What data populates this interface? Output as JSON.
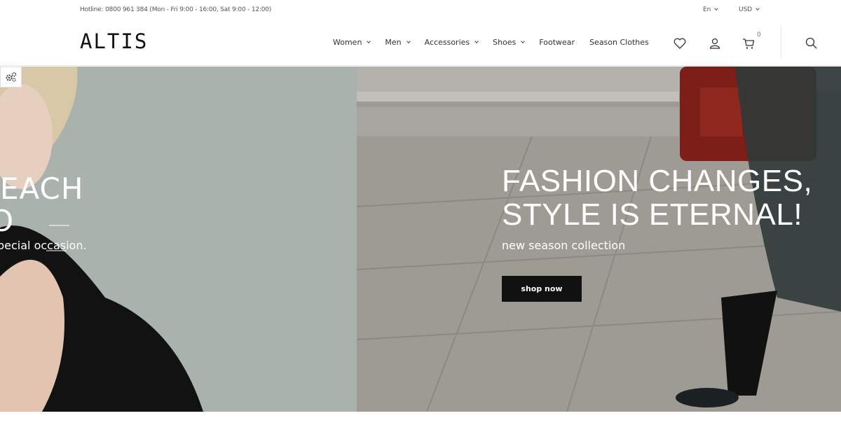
{
  "topbar": {
    "hotline": "Hotline: 0800 961 384 (Mon - Fri 9:00 - 16:00, Sat 9:00 - 12:00)",
    "language": "En",
    "currency": "USD"
  },
  "header": {
    "logo": "ALTIS",
    "nav": [
      {
        "label": "Women",
        "has_dropdown": true
      },
      {
        "label": "Men",
        "has_dropdown": true
      },
      {
        "label": "Accessories",
        "has_dropdown": true
      },
      {
        "label": "Shoes",
        "has_dropdown": true
      },
      {
        "label": "Footwear",
        "has_dropdown": false
      },
      {
        "label": "Season Clothes",
        "has_dropdown": false
      }
    ],
    "icons": [
      "heart-icon",
      "user-icon",
      "cart-icon",
      "search-icon"
    ],
    "cart_count": "0"
  },
  "hero": {
    "prev_slide": {
      "title_fragment": "EACH",
      "subtitle_fragment": "pecial occasion."
    },
    "slide": {
      "title_line1": "FASHION CHANGES,",
      "title_line2": "STYLE IS ETERNAL!",
      "subtitle": "new season collection",
      "button": "shop now"
    }
  },
  "colors": {
    "accent": "#111111",
    "hero_left_bg": "#aab3ad",
    "hero_right_bg": "#9c9a94"
  }
}
